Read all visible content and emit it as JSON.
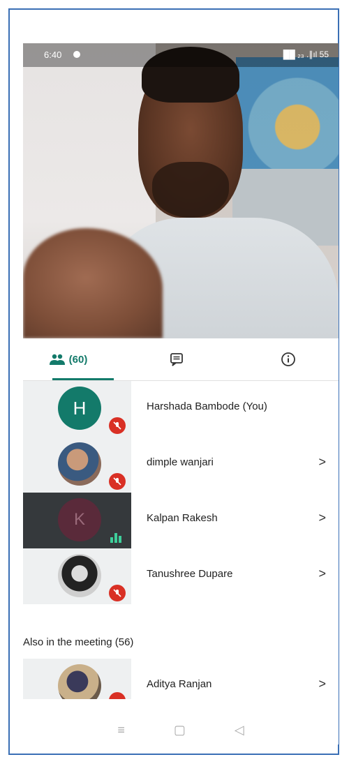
{
  "status": {
    "time": "6:40",
    "right": "██ ₂₃ .∥ıl 55"
  },
  "tabs": {
    "people_count": "(60)",
    "people_icon": "people-icon",
    "chat_icon": "chat-icon",
    "info_icon": "info-icon"
  },
  "participants": [
    {
      "name": "Harshada Bambode (You)",
      "initial": "H",
      "avatar_color": "#137a6a",
      "state": "muted",
      "has_chevron": false
    },
    {
      "name": "dimple wanjari",
      "initial": "",
      "avatar_color": "#8a6a5a",
      "state": "muted",
      "has_chevron": true,
      "chevron": ">"
    },
    {
      "name": "Kalpan Rakesh",
      "initial": "K",
      "avatar_color": "#5a2a3a",
      "state": "speaking",
      "has_chevron": true,
      "chevron": ">"
    },
    {
      "name": "Tanushree Dupare",
      "initial": "",
      "avatar_color": "#4a4a4a",
      "state": "muted",
      "has_chevron": true,
      "chevron": ">"
    }
  ],
  "also_title": "Also in the meeting (56)",
  "also_participants": [
    {
      "name": "Aditya Ranjan",
      "chevron": ">"
    }
  ],
  "colors": {
    "accent": "#137a6a",
    "muted_red": "#d93025",
    "speaking_green": "#3ecf9b"
  }
}
